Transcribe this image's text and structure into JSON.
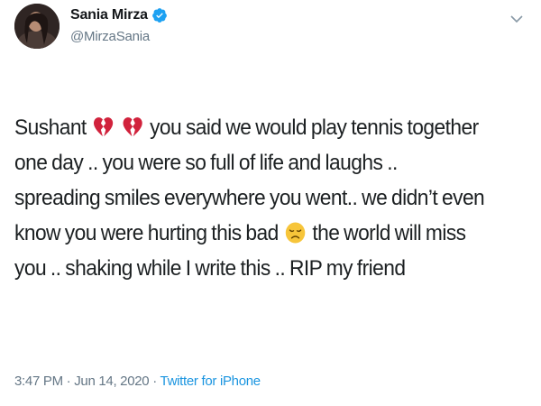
{
  "author": {
    "display_name": "Sania Mirza",
    "handle": "@MirzaSania",
    "verified": true
  },
  "menu": {
    "icon": "chevron-down-icon"
  },
  "tweet": {
    "line1_start": "Sushant",
    "line1_emojis": [
      "broken-heart-emoji",
      "broken-heart-emoji"
    ],
    "line1_end": "you said we would  play tennis together",
    "line2": "one day .. you were so full of life and laughs  ..",
    "line3": "spreading smiles everywhere you went.. we didn’t even",
    "line4_start": "know you were hurting this bad",
    "line4_emoji": "sad-face-emoji",
    "line4_end": "the world will miss",
    "line5": "you .. shaking while I write this .. RIP my friend"
  },
  "meta": {
    "time": "3:47 PM",
    "separator1": " · ",
    "date": "Jun 14, 2020",
    "separator2": " · ",
    "source": "Twitter for iPhone"
  },
  "colors": {
    "verified": "#1da1f2",
    "source_link": "#1b95e0",
    "secondary_text": "#657786",
    "broken_heart": "#d1223c",
    "sad_face": "#f7c53a"
  }
}
